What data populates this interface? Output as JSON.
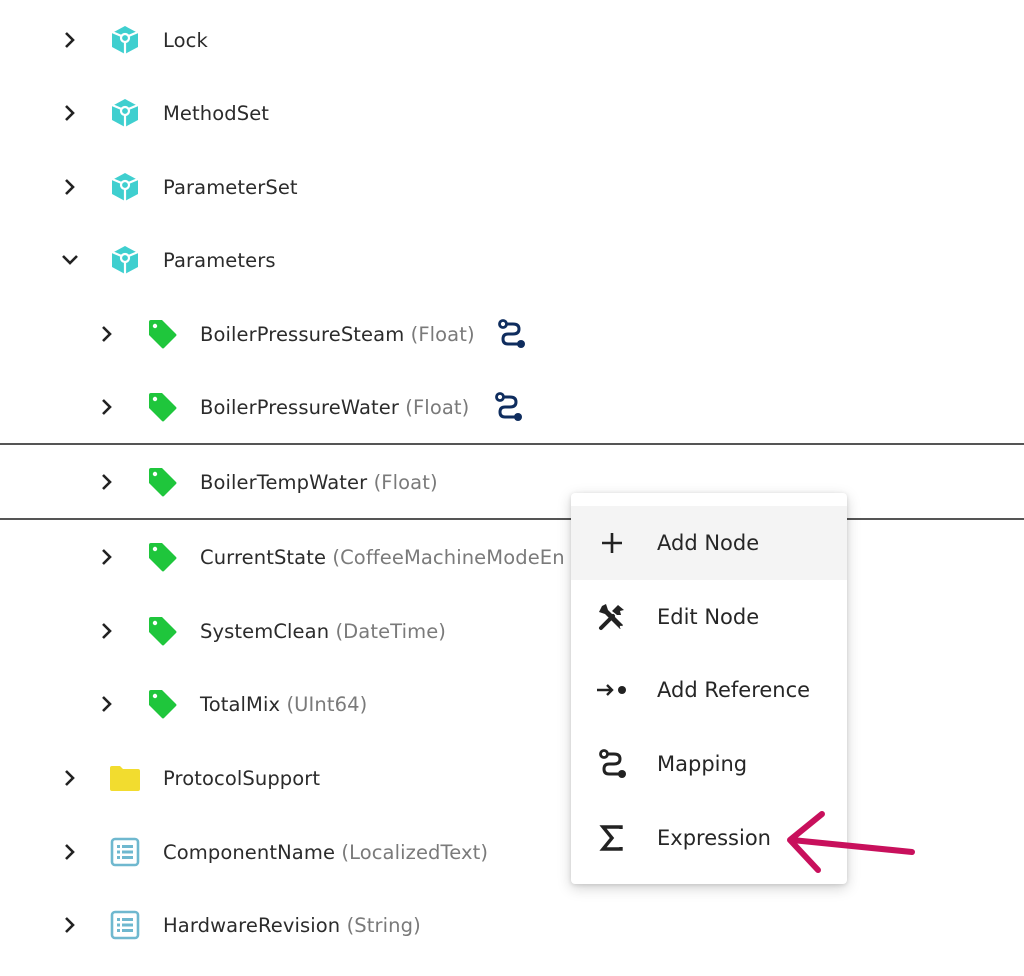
{
  "tree": {
    "items": [
      {
        "name": "Lock",
        "type": "",
        "level": 0,
        "expanded": false,
        "icon": "object-cube-icon"
      },
      {
        "name": "MethodSet",
        "type": "",
        "level": 0,
        "expanded": false,
        "icon": "object-cube-icon"
      },
      {
        "name": "ParameterSet",
        "type": "",
        "level": 0,
        "expanded": false,
        "icon": "object-cube-icon"
      },
      {
        "name": "Parameters",
        "type": "",
        "level": 0,
        "expanded": true,
        "icon": "object-cube-icon"
      },
      {
        "name": "BoilerPressureSteam",
        "type": "(Float)",
        "level": 1,
        "expanded": false,
        "icon": "variable-tag-icon",
        "mapped": true
      },
      {
        "name": "BoilerPressureWater",
        "type": "(Float)",
        "level": 1,
        "expanded": false,
        "icon": "variable-tag-icon",
        "mapped": true
      },
      {
        "name": "BoilerTempWater",
        "type": "(Float)",
        "level": 1,
        "expanded": false,
        "icon": "variable-tag-icon",
        "selected": true
      },
      {
        "name": "CurrentState",
        "type": "(CoffeeMachineModeEn",
        "level": 1,
        "expanded": false,
        "icon": "variable-tag-icon"
      },
      {
        "name": "SystemClean",
        "type": "(DateTime)",
        "level": 1,
        "expanded": false,
        "icon": "variable-tag-icon"
      },
      {
        "name": "TotalMix",
        "type": "(UInt64)",
        "level": 1,
        "expanded": false,
        "icon": "variable-tag-icon"
      },
      {
        "name": "ProtocolSupport",
        "type": "",
        "level": 0,
        "expanded": false,
        "icon": "folder-icon"
      },
      {
        "name": "ComponentName",
        "type": "(LocalizedText)",
        "level": 0,
        "expanded": false,
        "icon": "property-list-icon"
      },
      {
        "name": "HardwareRevision",
        "type": "(String)",
        "level": 0,
        "expanded": false,
        "icon": "property-list-icon"
      }
    ]
  },
  "context_menu": {
    "items": [
      {
        "label": "Add Node",
        "icon": "plus-icon"
      },
      {
        "label": "Edit Node",
        "icon": "tools-icon"
      },
      {
        "label": "Add Reference",
        "icon": "arrow-reference-icon"
      },
      {
        "label": "Mapping",
        "icon": "mapping-icon"
      },
      {
        "label": "Expression",
        "icon": "sigma-icon"
      }
    ],
    "hovered_index": 0
  },
  "colors": {
    "object_icon": "#3fcfcf",
    "variable_icon": "#1fc63c",
    "folder_icon": "#f2dc2f",
    "property_icon": "#6fb8cf",
    "mapping_badge": "#0f2d5e",
    "annotation_arrow": "#c8105c"
  }
}
